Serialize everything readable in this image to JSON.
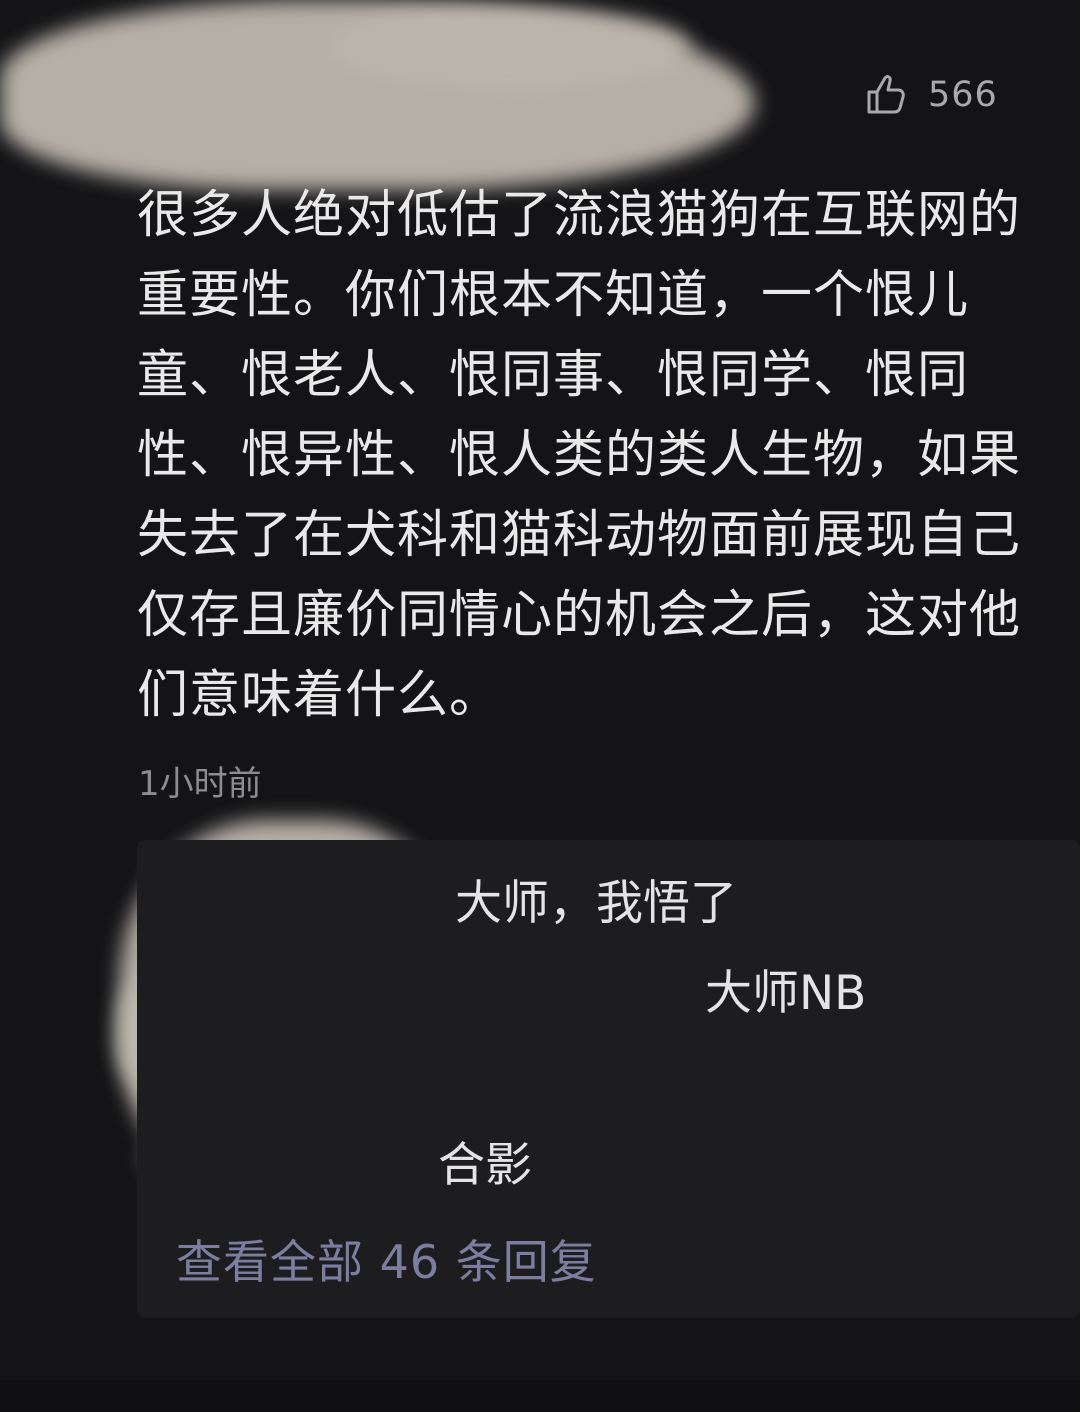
{
  "comment": {
    "likes": "566",
    "overflow_label": "⋮",
    "lines": [
      "很多人绝对低估了流浪猫狗在互联网的",
      "重要性。你们根本不知道，一个恨儿",
      "童、恨老人、恨同事、恨同学、恨同",
      "性、恨异性、恨人类的类人生物，如果",
      "失去了在犬科和猫科动物面前展现自己",
      "仅存且廉价同情心的机会之后，这对他",
      "们意味着什么。"
    ],
    "time": "1小时前"
  },
  "replies": {
    "items": [
      "大师，我悟了",
      "大师NB",
      "合影"
    ],
    "view_all": "查看全部 46 条回复"
  },
  "colors": {
    "background": "#141416",
    "text": "#e9e9ea",
    "muted": "#8c8c91",
    "link": "#7d7da1",
    "reply_panel": "#1d1d20",
    "redaction": "#bdb6ad"
  },
  "icons": {
    "like": "thumbs-up-icon",
    "more": "more-icon"
  }
}
